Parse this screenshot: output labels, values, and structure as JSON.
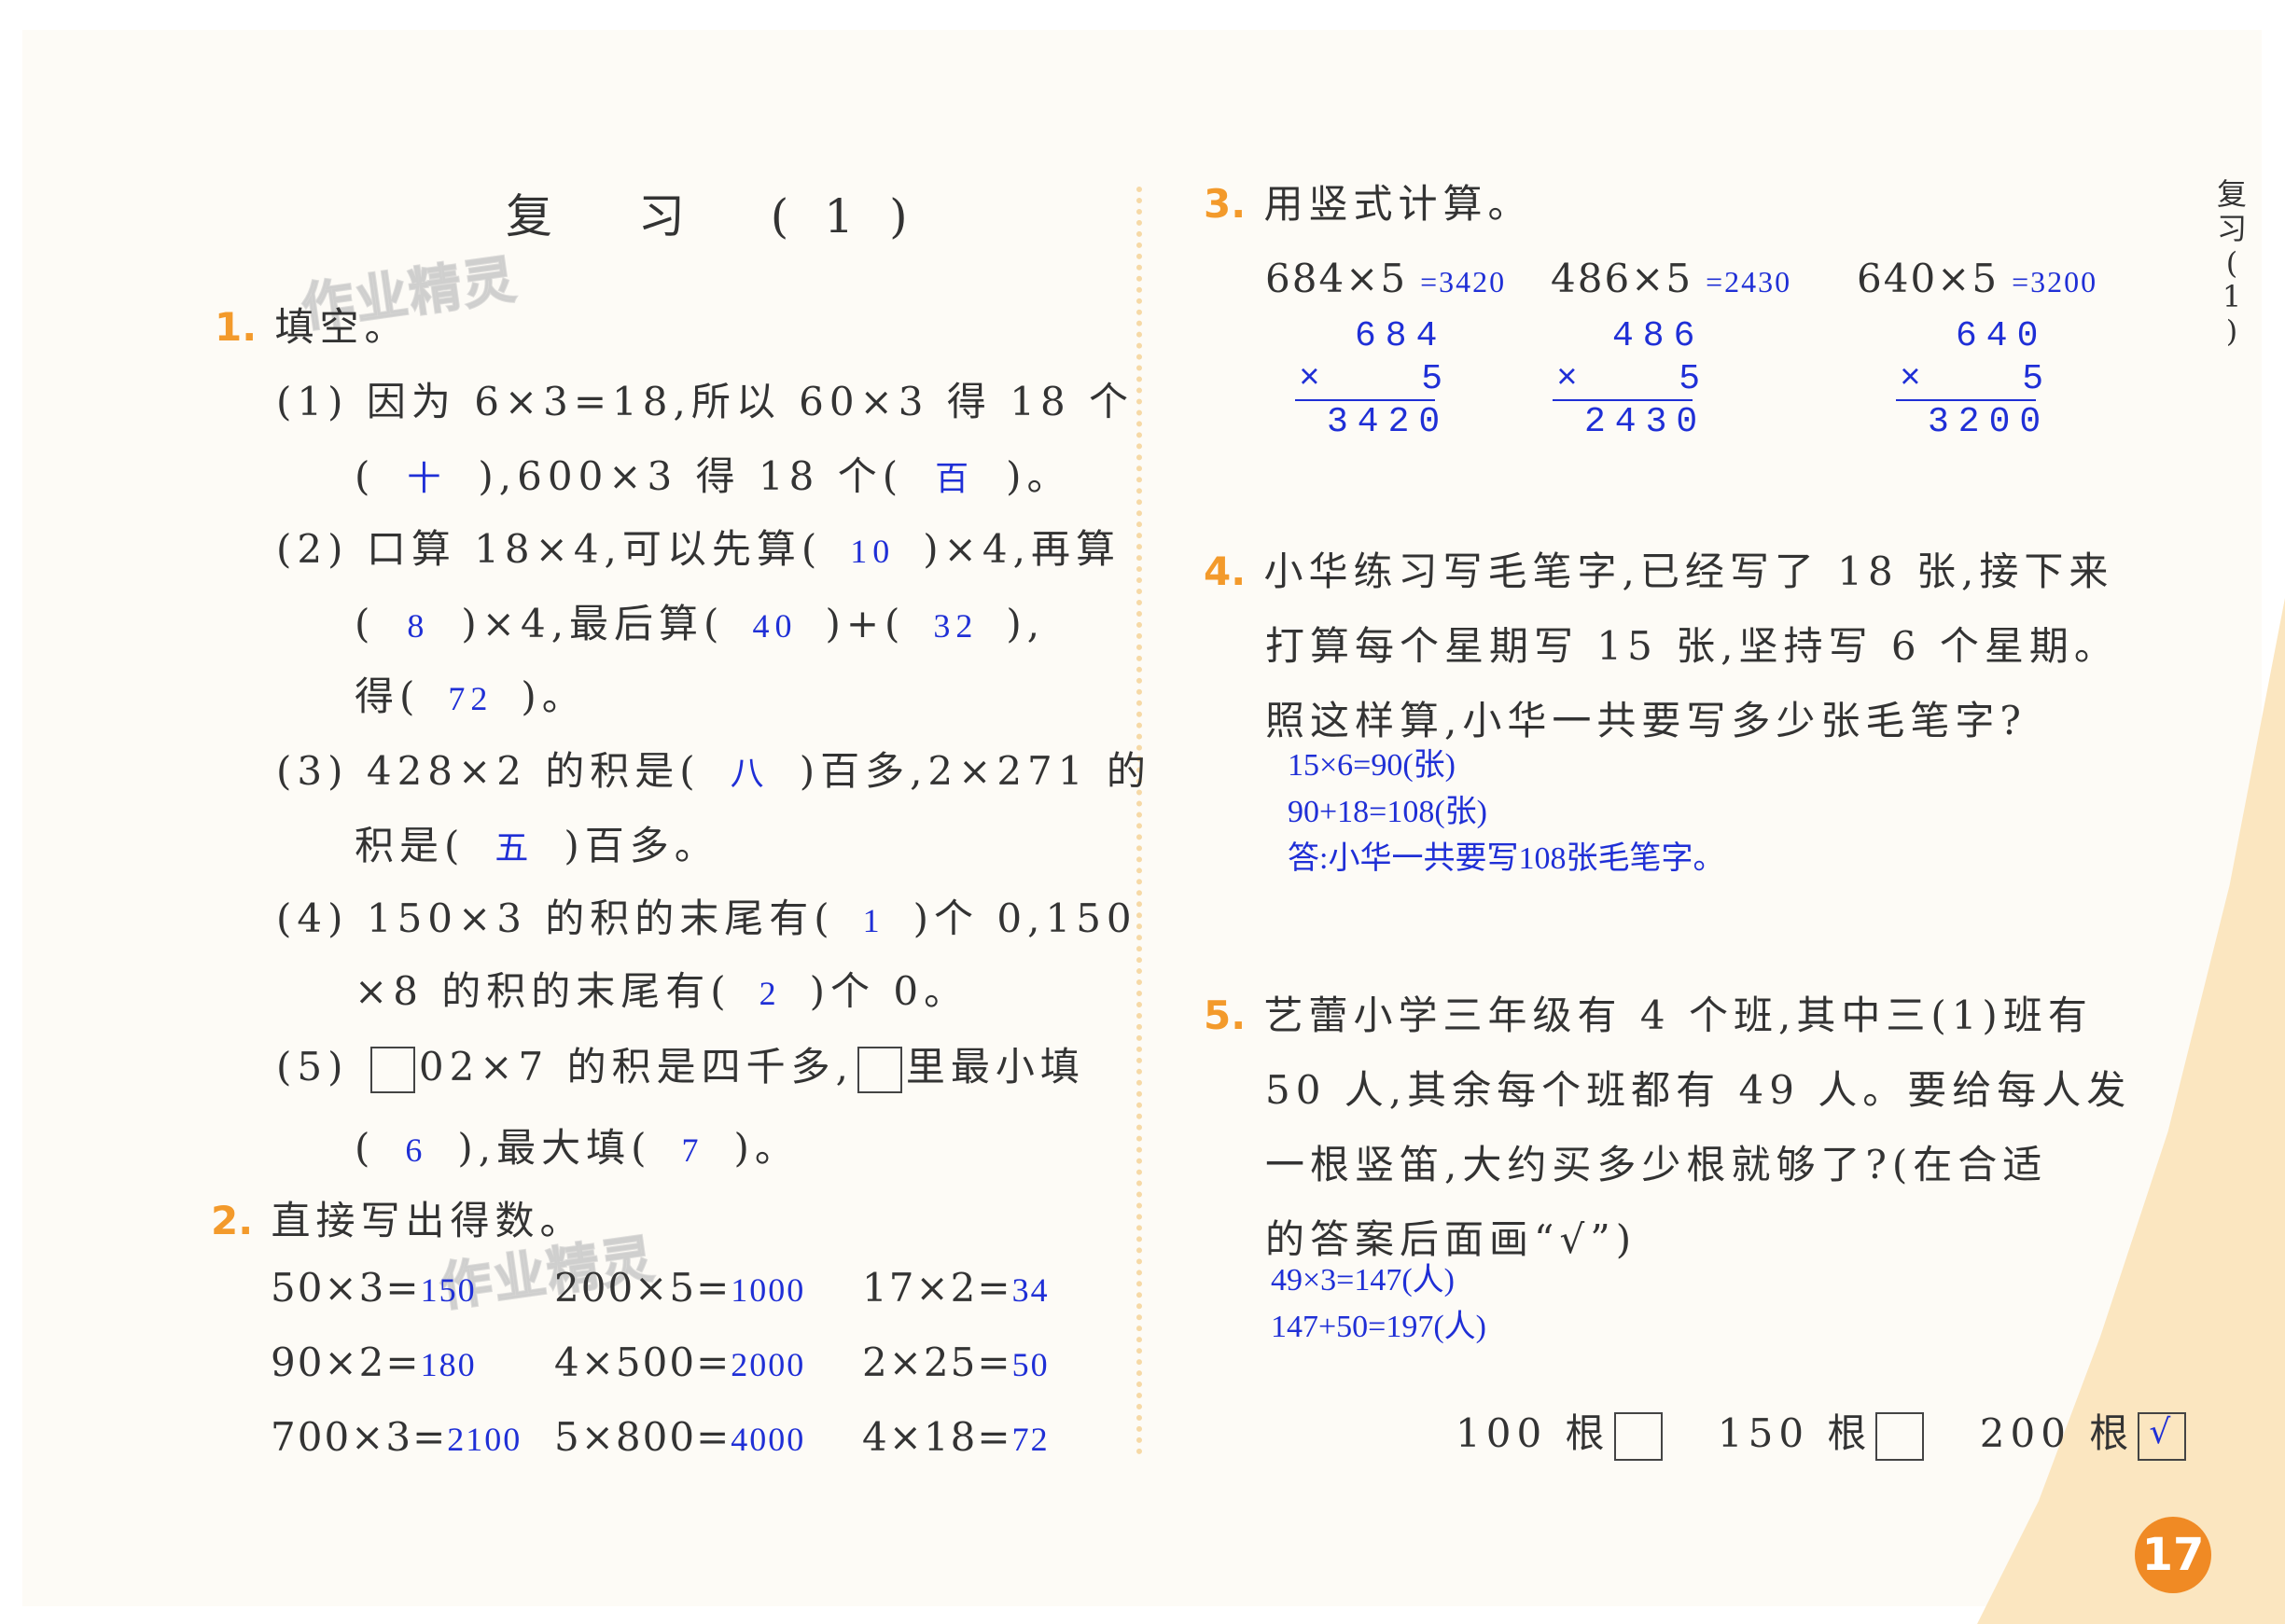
{
  "title": "复 习 (1)",
  "watermark": "作业精灵",
  "side_label": [
    "复",
    "习",
    "(",
    "1",
    ")"
  ],
  "page_number": "17",
  "q1": {
    "num": "1.",
    "head": "填空。",
    "p1_l1": "(1) 因为 6×3=18,所以 60×3 得 18 个",
    "p1_l2a": "(",
    "p1_a1": "十",
    "p1_l2b": "),600×3 得 18 个(",
    "p1_a2": "百",
    "p1_l2c": ")。",
    "p2_l1a": "(2) 口算 18×4,可以先算(",
    "p2_a1": "10",
    "p2_l1b": ")×4,再算",
    "p2_l2a": "(",
    "p2_a2": "8",
    "p2_l2b": ")×4,最后算(",
    "p2_a3": "40",
    "p2_l2c": ")+(",
    "p2_a4": "32",
    "p2_l2d": "),",
    "p2_l3a": "得(",
    "p2_a5": "72",
    "p2_l3b": ")。",
    "p3_l1a": "(3) 428×2 的积是(",
    "p3_a1": "八",
    "p3_l1b": ")百多,2×271 的",
    "p3_l2a": "积是(",
    "p3_a2": "五",
    "p3_l2b": ")百多。",
    "p4_l1a": "(4) 150×3 的积的末尾有(",
    "p4_a1": "1",
    "p4_l1b": ")个 0,150",
    "p4_l2a": "×8 的积的末尾有(",
    "p4_a2": "2",
    "p4_l2b": ")个 0。",
    "p5_l1a": "(5)",
    "p5_l1b": "02×7 的积是四千多,",
    "p5_l1c": "里最小填",
    "p5_l2a": "(",
    "p5_a1": "6",
    "p5_l2b": "),最大填(",
    "p5_a2": "7",
    "p5_l2c": ")。"
  },
  "q2": {
    "num": "2.",
    "head": "直接写出得数。",
    "items": [
      {
        "expr": "50×3=",
        "ans": "150"
      },
      {
        "expr": "200×5=",
        "ans": "1000"
      },
      {
        "expr": "17×2=",
        "ans": "34"
      },
      {
        "expr": "90×2=",
        "ans": "180"
      },
      {
        "expr": "4×500=",
        "ans": "2000"
      },
      {
        "expr": "2×25=",
        "ans": "50"
      },
      {
        "expr": "700×3=",
        "ans": "2100"
      },
      {
        "expr": "5×800=",
        "ans": "4000"
      },
      {
        "expr": "4×18=",
        "ans": "72"
      }
    ]
  },
  "q3": {
    "num": "3.",
    "head": "用竖式计算。",
    "items": [
      {
        "expr": "684×5",
        "ans": "=3420",
        "top": "684",
        "mul": "×   5",
        "res": "3420"
      },
      {
        "expr": "486×5",
        "ans": "=2430",
        "top": "486",
        "mul": "×   5",
        "res": "2430"
      },
      {
        "expr": "640×5",
        "ans": "=3200",
        "top": "640",
        "mul": "×   5",
        "res": "3200"
      }
    ]
  },
  "q4": {
    "num": "4.",
    "l1": "小华练习写毛笔字,已经写了 18 张,接下来",
    "l2": "打算每个星期写 15 张,坚持写 6 个星期。",
    "l3": "照这样算,小华一共要写多少张毛笔字?",
    "a1": "15×6=90(张)",
    "a2": "90+18=108(张)",
    "a3": "答:小华一共要写108张毛笔字。"
  },
  "q5": {
    "num": "5.",
    "l1": "艺蕾小学三年级有 4 个班,其中三(1)班有",
    "l2": "50 人,其余每个班都有 49 人。要给每人发",
    "l3": "一根竖笛,大约买多少根就够了?(在合适",
    "l4": "的答案后面画“√”)",
    "a1": "49×3=147(人)",
    "a2": "147+50=197(人)",
    "opt1": "100 根",
    "opt2": "150 根",
    "opt3": "200 根",
    "check": "√"
  }
}
